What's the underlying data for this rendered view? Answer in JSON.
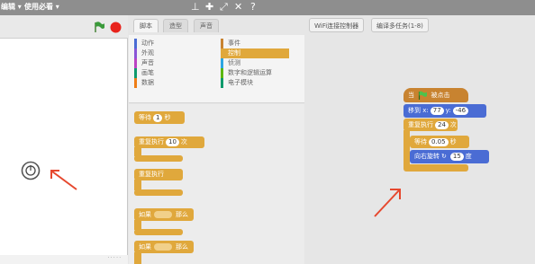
{
  "menu": {
    "file": "编辑 ▾",
    "use": "使用必看 ▾"
  },
  "palette": {
    "tabs": [
      "脚本",
      "造型",
      "声音"
    ],
    "categories_left": [
      "动作",
      "外观",
      "声音",
      "画笔",
      "数据"
    ],
    "categories_right": [
      "事件",
      "控制",
      "侦测",
      "数字和逻辑运算",
      "电子模块"
    ],
    "blocks": {
      "wait": "等待",
      "wait_value": "1",
      "wait_unit": "秒",
      "repeat": "重复执行",
      "repeat_value": "10",
      "repeat_unit": "次",
      "forever": "重复执行",
      "if1": "如果",
      "if1_then": "那么",
      "if2": "如果",
      "if2_then": "那么"
    }
  },
  "script_area": {
    "buttons": [
      "WiFi连接控制器",
      "编译多任务(1-8)"
    ],
    "script": {
      "hat": "当",
      "hat_suffix": "被点击",
      "move_label": "移到 x:",
      "x_value": "77",
      "y_label": "y:",
      "y_value": "-46",
      "repeat_label": "重复执行",
      "repeat_value": "24",
      "repeat_unit": "次",
      "wait_label": "等待",
      "wait_value": "0.05",
      "wait_unit": "秒",
      "turn_label": "向右旋转",
      "turn_value": "15",
      "turn_unit": "度"
    }
  },
  "colors": {
    "control": "#e0a83c",
    "motion": "#4a6cd4",
    "events": "#c88330",
    "green_flag": "#3a9a3a",
    "stop": "#e8231c",
    "arrow": "#e6482e"
  }
}
